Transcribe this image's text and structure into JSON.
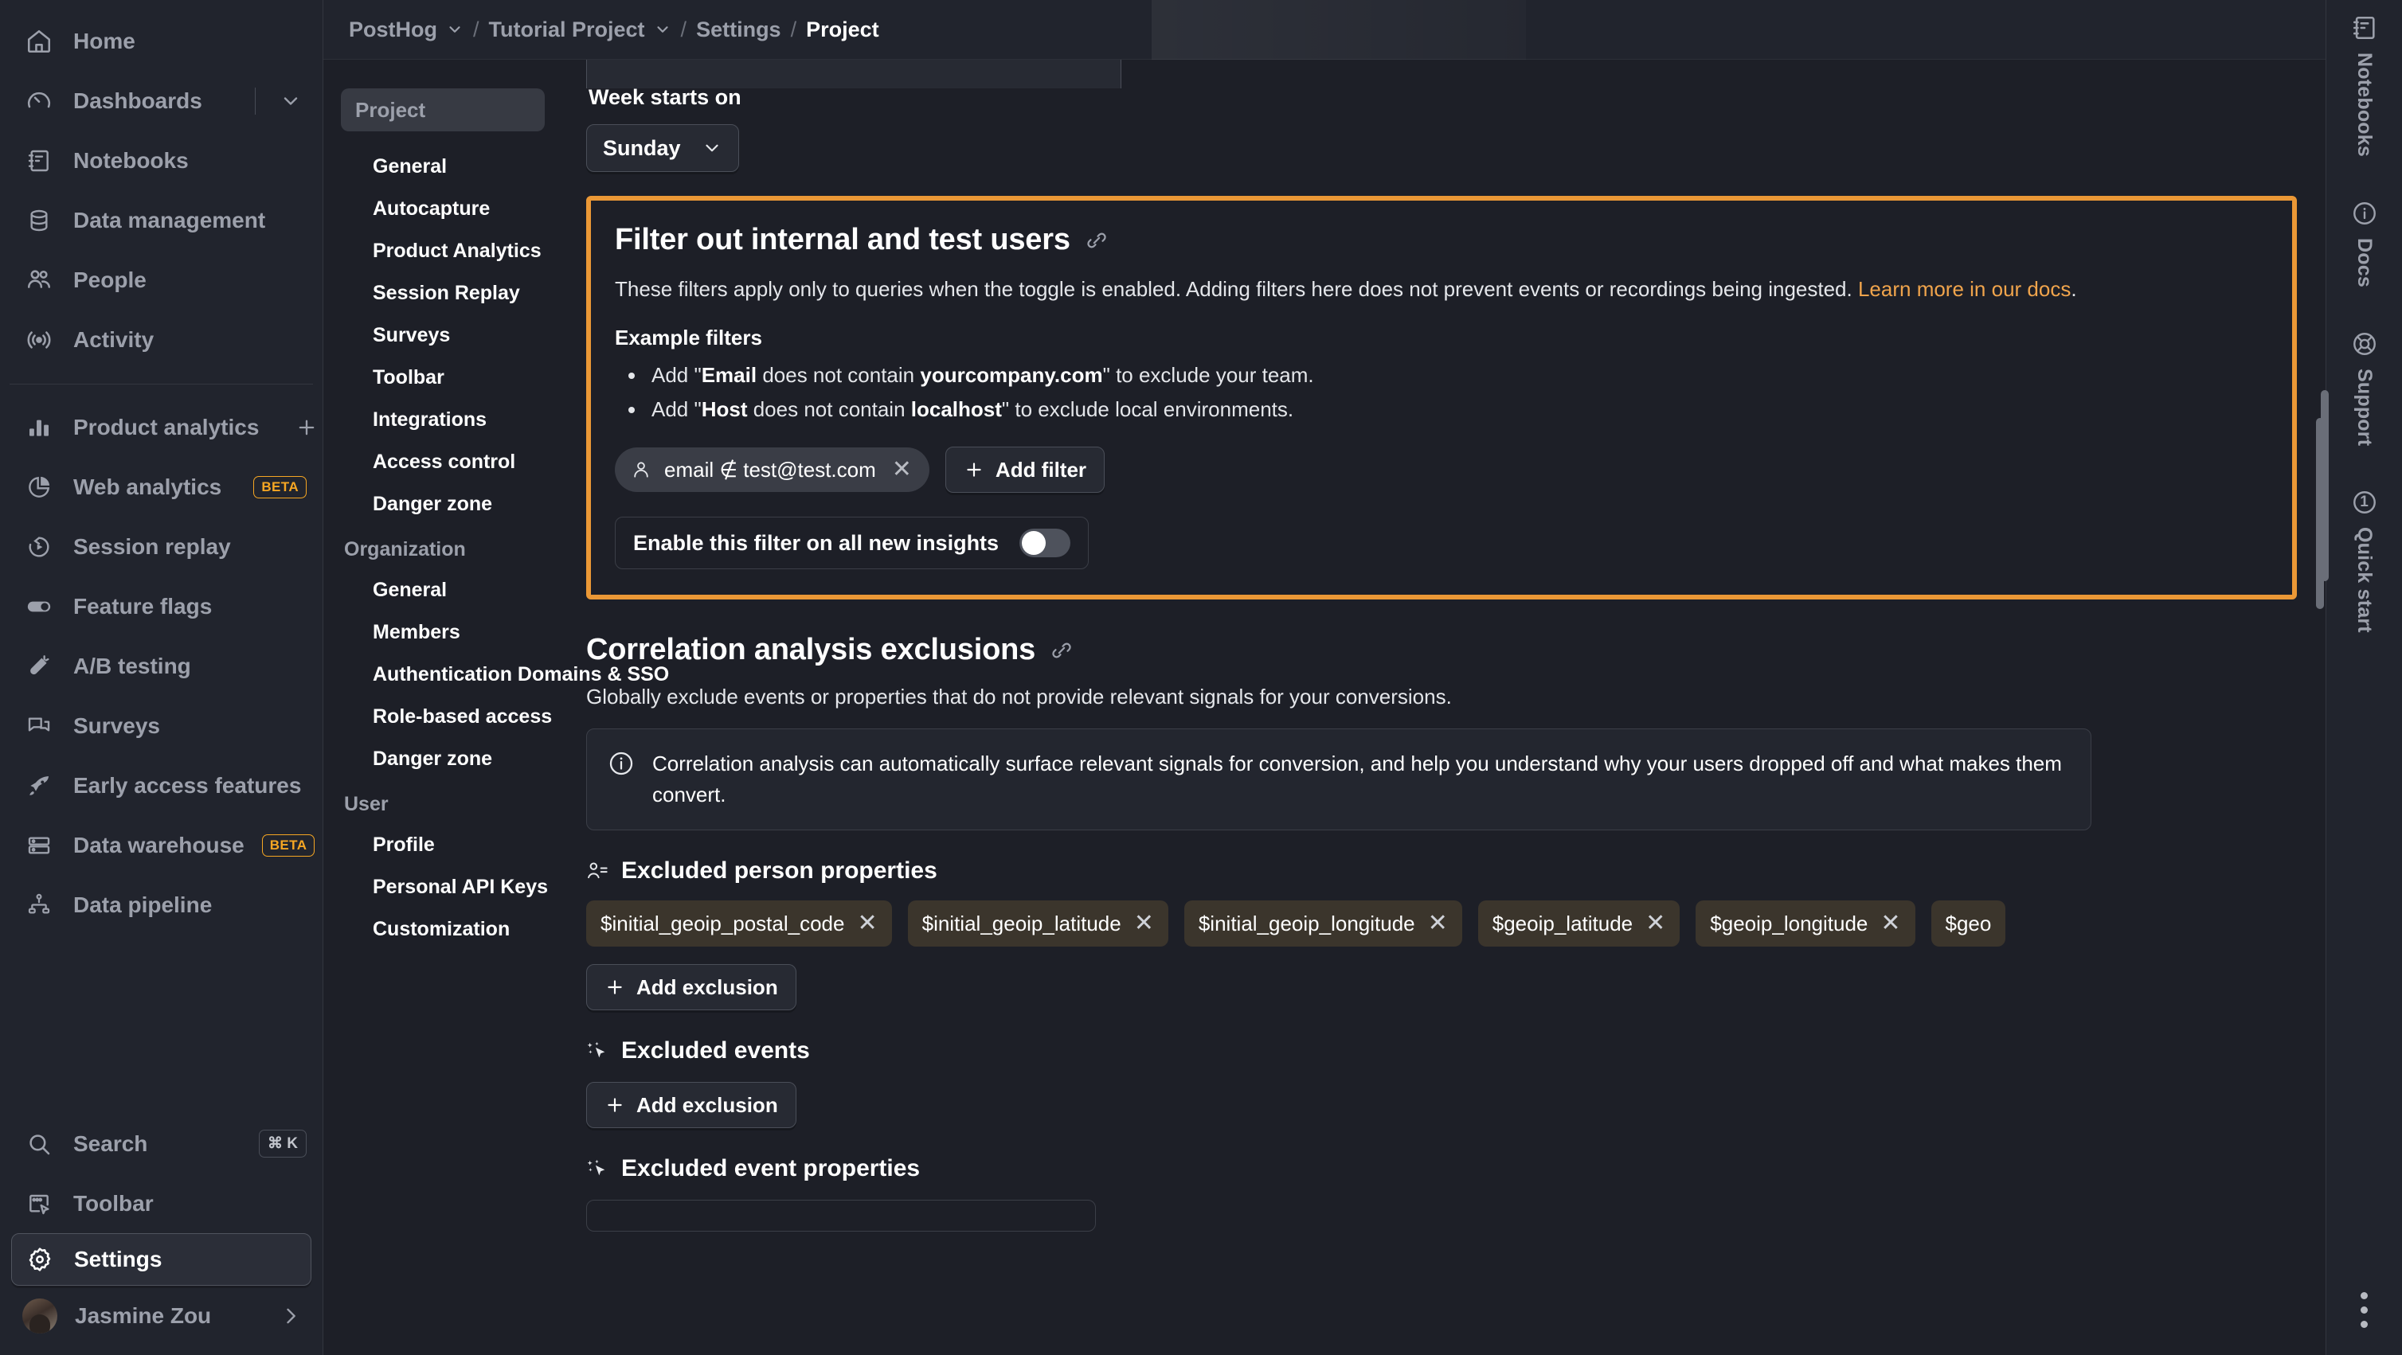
{
  "left_sidebar": {
    "primary": [
      {
        "label": "Home",
        "icon": "home-icon"
      },
      {
        "label": "Dashboards",
        "icon": "gauge-icon",
        "trailing": "chevron-down-icon"
      },
      {
        "label": "Notebooks",
        "icon": "notebook-icon"
      },
      {
        "label": "Data management",
        "icon": "database-icon"
      },
      {
        "label": "People",
        "icon": "people-icon"
      },
      {
        "label": "Activity",
        "icon": "activity-icon"
      }
    ],
    "products": [
      {
        "label": "Product analytics",
        "icon": "bar-chart-icon",
        "trailing": "plus-icon"
      },
      {
        "label": "Web analytics",
        "icon": "pie-chart-icon",
        "badge": "BETA"
      },
      {
        "label": "Session replay",
        "icon": "replay-icon"
      },
      {
        "label": "Feature flags",
        "icon": "toggle-icon"
      },
      {
        "label": "A/B testing",
        "icon": "flask-icon"
      },
      {
        "label": "Surveys",
        "icon": "survey-icon"
      },
      {
        "label": "Early access features",
        "icon": "rocket-icon"
      },
      {
        "label": "Data warehouse",
        "icon": "warehouse-icon",
        "badge": "BETA"
      },
      {
        "label": "Data pipeline",
        "icon": "pipeline-icon"
      }
    ],
    "bottom": [
      {
        "label": "Search",
        "icon": "search-icon",
        "shortcut": "⌘ K"
      },
      {
        "label": "Toolbar",
        "icon": "toolbar-icon"
      },
      {
        "label": "Settings",
        "icon": "gear-icon",
        "active": true
      }
    ],
    "user": {
      "name": "Jasmine Zou",
      "icon": "avatar",
      "trailing": "chevron-right-icon"
    }
  },
  "breadcrumb": {
    "items": [
      {
        "label": "PostHog",
        "has_chevron": true
      },
      {
        "label": "Tutorial Project",
        "has_chevron": true
      },
      {
        "label": "Settings",
        "has_chevron": false
      },
      {
        "label": "Project",
        "has_chevron": false,
        "current": true
      }
    ],
    "separator": "/"
  },
  "settings_nav": {
    "search_placeholder": "Project",
    "groups": [
      {
        "title": "",
        "items": [
          "General",
          "Autocapture",
          "Product Analytics",
          "Session Replay",
          "Surveys",
          "Toolbar",
          "Integrations",
          "Access control",
          "Danger zone"
        ]
      },
      {
        "title": "Organization",
        "items": [
          "General",
          "Members",
          "Authentication Domains & SSO",
          "Role-based access",
          "Danger zone"
        ]
      },
      {
        "title": "User",
        "items": [
          "Profile",
          "Personal API Keys",
          "Customization"
        ]
      }
    ]
  },
  "content": {
    "week_starts_on": {
      "label": "Week starts on",
      "value": "Sunday",
      "chevron": "chevron-down-icon"
    },
    "filter_section": {
      "title": "Filter out internal and test users",
      "link_icon": "link-icon",
      "description_part1": "These filters apply only to queries when the toggle is enabled. Adding filters here does not prevent events or recordings being ingested. ",
      "description_link": "Learn more in our docs",
      "description_end": ".",
      "examples_title": "Example filters",
      "examples": [
        {
          "prefix": "Add \"",
          "bold1": "Email",
          "mid": " does not contain ",
          "bold2": "yourcompany.com",
          "suffix": "\" to exclude your team."
        },
        {
          "prefix": "Add \"",
          "bold1": "Host",
          "mid": " does not contain ",
          "bold2": "localhost",
          "suffix": "\" to exclude local environments."
        }
      ],
      "chip": {
        "icon": "person-icon",
        "text": "email ∉ test@test.com",
        "close": "close-icon"
      },
      "add_filter_label": "Add filter",
      "toggle": {
        "label": "Enable this filter on all new insights",
        "enabled": false
      }
    },
    "correlation_section": {
      "title": "Correlation analysis exclusions",
      "link_icon": "link-icon",
      "description": "Globally exclude events or properties that do not provide relevant signals for your conversions.",
      "info": "Correlation analysis can automatically surface relevant signals for conversion, and help you understand why your users dropped off and what makes them convert.",
      "info_icon": "info-icon",
      "excluded_person_properties": {
        "label": "Excluded person properties",
        "icon": "person-properties-icon",
        "chips": [
          "$initial_geoip_postal_code",
          "$initial_geoip_latitude",
          "$initial_geoip_longitude",
          "$geoip_latitude",
          "$geoip_longitude",
          "$geo"
        ],
        "add_label": "Add exclusion"
      },
      "excluded_events": {
        "label": "Excluded events",
        "icon": "sparkle-cursor-icon",
        "add_label": "Add exclusion"
      },
      "excluded_event_properties": {
        "label": "Excluded event properties",
        "icon": "sparkle-cursor-icon"
      }
    }
  },
  "right_sidebar": {
    "items": [
      {
        "label": "Notebooks",
        "icon": "notebook-icon"
      },
      {
        "label": "Docs",
        "icon": "info-circle-icon"
      },
      {
        "label": "Support",
        "icon": "lifebuoy-icon"
      },
      {
        "label": "Quick start",
        "icon": "counter-icon",
        "count": "1"
      }
    ],
    "more_icon": "more-vertical-icon"
  },
  "colors": {
    "accent": "#f5a623",
    "highlight_border": "#eb9836",
    "bg": "#1d1f27",
    "panel": "#21242d"
  }
}
